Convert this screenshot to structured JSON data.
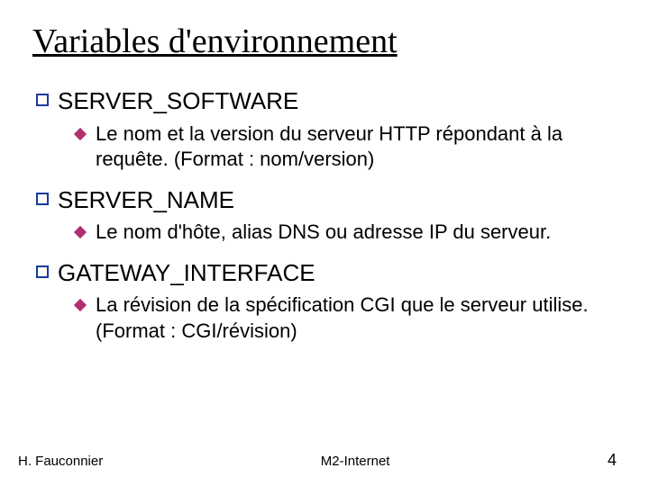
{
  "title": "Variables d'environnement",
  "items": [
    {
      "heading": "SERVER_SOFTWARE",
      "desc": "Le nom et la version du serveur HTTP répondant à la requête. (Format : nom/version)"
    },
    {
      "heading": "SERVER_NAME",
      "desc": "Le nom d'hôte, alias DNS ou adresse IP du serveur."
    },
    {
      "heading": "GATEWAY_INTERFACE",
      "desc": "La révision de la spécification CGI que le serveur utilise. (Format : CGI/révision)"
    }
  ],
  "footer": {
    "author": "H. Fauconnier",
    "course": "M2-Internet",
    "page": "4"
  }
}
